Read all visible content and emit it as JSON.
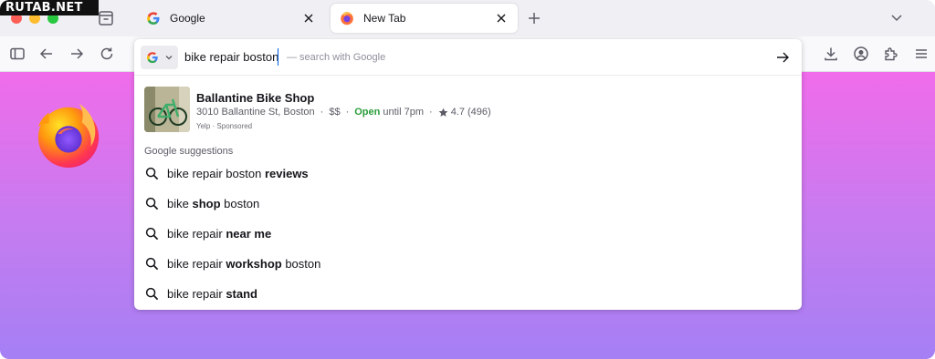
{
  "watermark": "RUTAB.NET",
  "tabs": [
    {
      "title": "Google",
      "favicon": "google-g-icon",
      "active": false
    },
    {
      "title": "New Tab",
      "favicon": "firefox-icon",
      "active": true
    }
  ],
  "urlbar": {
    "engine_icon": "google-g-icon",
    "value": "bike repair boston",
    "hint": "— search with Google"
  },
  "sponsored_result": {
    "name": "Ballantine Bike Shop",
    "address": "3010 Ballantine St, Boston",
    "price": "$$",
    "open_label": "Open",
    "hours": "until 7pm",
    "rating": "4.7",
    "reviews": "(496)",
    "source": "Yelp",
    "tag": "Sponsored"
  },
  "suggestions_header": "Google suggestions",
  "suggestions": [
    {
      "normal_before": "bike repair boston ",
      "bold": "reviews",
      "normal_after": ""
    },
    {
      "normal_before": "bike ",
      "bold": "shop",
      "normal_after": " boston"
    },
    {
      "normal_before": "bike repair ",
      "bold": "near me",
      "normal_after": ""
    },
    {
      "normal_before": "bike repair ",
      "bold": "workshop",
      "normal_after": " boston"
    },
    {
      "normal_before": "bike repair ",
      "bold": "stand",
      "normal_after": ""
    }
  ],
  "colors": {
    "accent": "#0060df",
    "open": "#2a9d3a",
    "gradient_top": "#f06ceb",
    "gradient_bottom": "#a57ff4"
  }
}
